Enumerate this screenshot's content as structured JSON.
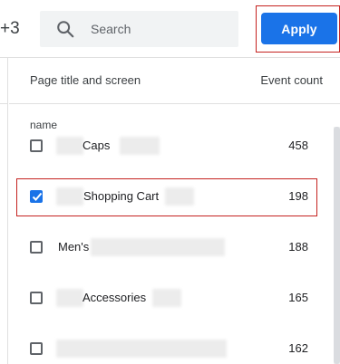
{
  "topbar": {
    "selected_count": "+3",
    "search": {
      "placeholder": "Search",
      "value": ""
    },
    "apply_label": "Apply"
  },
  "table": {
    "header": {
      "title": "Page title and screen",
      "count": "Event count"
    },
    "dimension_label": "name",
    "rows": [
      {
        "label": "Caps",
        "value": "458",
        "checked": false
      },
      {
        "label": "Shopping Cart",
        "value": "198",
        "checked": true
      },
      {
        "label": "Men's",
        "value": "188",
        "checked": false
      },
      {
        "label": "Accessories",
        "value": "165",
        "checked": false
      },
      {
        "label": "",
        "value": "162",
        "checked": false
      }
    ]
  },
  "colors": {
    "accent": "#1a73e8",
    "highlight": "#c5221f"
  }
}
